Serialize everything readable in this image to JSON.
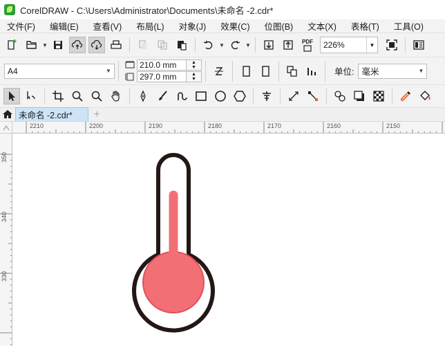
{
  "window": {
    "title": "CorelDRAW - C:\\Users\\Administrator\\Documents\\未命名 -2.cdr*"
  },
  "menu": [
    {
      "label": "文件(F)"
    },
    {
      "label": "编辑(E)"
    },
    {
      "label": "查看(V)"
    },
    {
      "label": "布局(L)"
    },
    {
      "label": "对象(J)"
    },
    {
      "label": "效果(C)"
    },
    {
      "label": "位图(B)"
    },
    {
      "label": "文本(X)"
    },
    {
      "label": "表格(T)"
    },
    {
      "label": "工具(O)"
    }
  ],
  "standard_toolbar": {
    "export_pdf_label": "PDF",
    "zoom_level": "226%"
  },
  "property_bar": {
    "page_size": "A4",
    "width": "210.0 mm",
    "height": "297.0 mm",
    "unit_label": "单位:",
    "unit_value": "毫米"
  },
  "document_tabs": [
    {
      "label": "未命名 -2.cdr*",
      "active": true
    }
  ],
  "rulers": {
    "horizontal_ticks": [
      "2210",
      "2200",
      "2190",
      "2180",
      "2170",
      "2160",
      "2150"
    ],
    "vertical_ticks": [
      "350",
      "340",
      "330"
    ]
  },
  "drawing": {
    "object": "thermometer",
    "outline_color": "#231815",
    "fill_color": "#f26f76",
    "stroke_color": "#e04f5e"
  },
  "colors": {
    "accent_tab": "#cde4f7",
    "app_logo": "#2e9e3a"
  }
}
